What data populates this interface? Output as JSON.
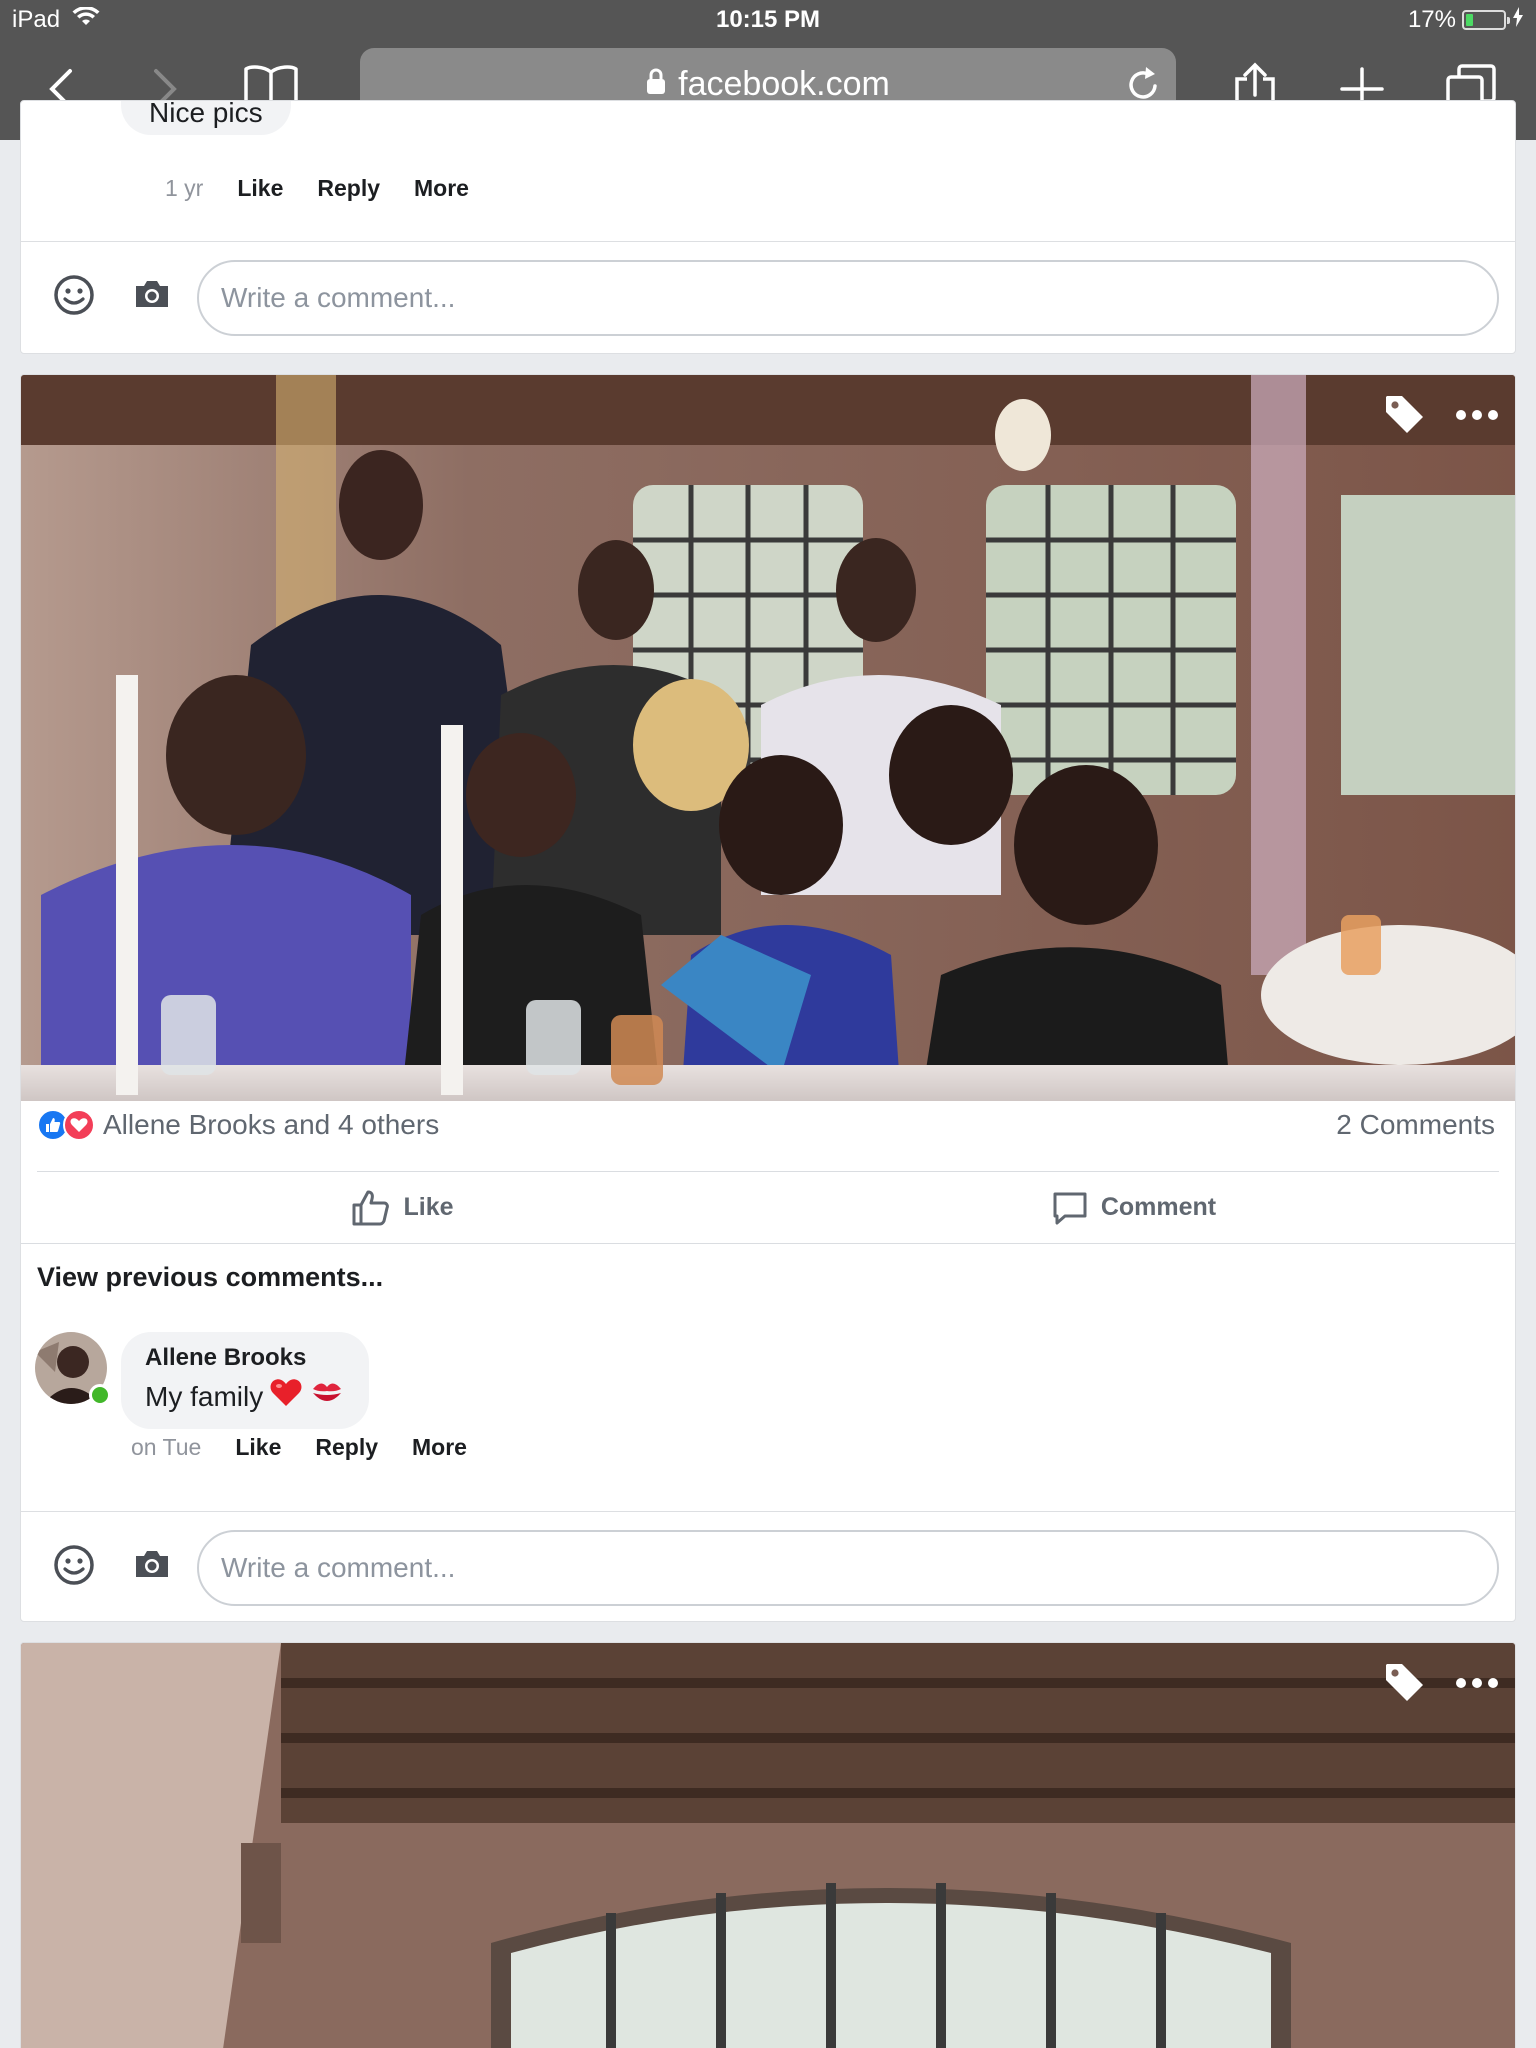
{
  "status_bar": {
    "device": "iPad",
    "time": "10:15 PM",
    "battery": "17%"
  },
  "browser": {
    "url": "facebook.com"
  },
  "prev_post": {
    "comment_tail_text": "Nice pics",
    "comment_meta": {
      "time": "1 yr",
      "like": "Like",
      "reply": "Reply",
      "more": "More"
    },
    "write_placeholder": "Write a comment..."
  },
  "post": {
    "reactions_text": "Allene Brooks and 4 others",
    "comments_count": "2 Comments",
    "actions": {
      "like": "Like",
      "comment": "Comment"
    },
    "view_previous": "View previous comments...",
    "comment": {
      "author": "Allene Brooks",
      "text": "My family",
      "meta": {
        "time": "on Tue",
        "like": "Like",
        "reply": "Reply",
        "more": "More"
      }
    },
    "write_placeholder": "Write a comment..."
  },
  "icons": {
    "back": "chevron-left-icon",
    "forward": "chevron-right-icon",
    "bookmarks": "book-icon",
    "share": "share-icon",
    "new_tab": "plus-icon",
    "tabs": "tabs-icon",
    "tag": "tag-icon",
    "more": "ellipsis-icon"
  },
  "colors": {
    "toolbar": "#555555",
    "facebook_blue": "#1877f2",
    "love_red": "#f33e58",
    "online_green": "#42b72a",
    "battery_green": "#4cd964"
  }
}
